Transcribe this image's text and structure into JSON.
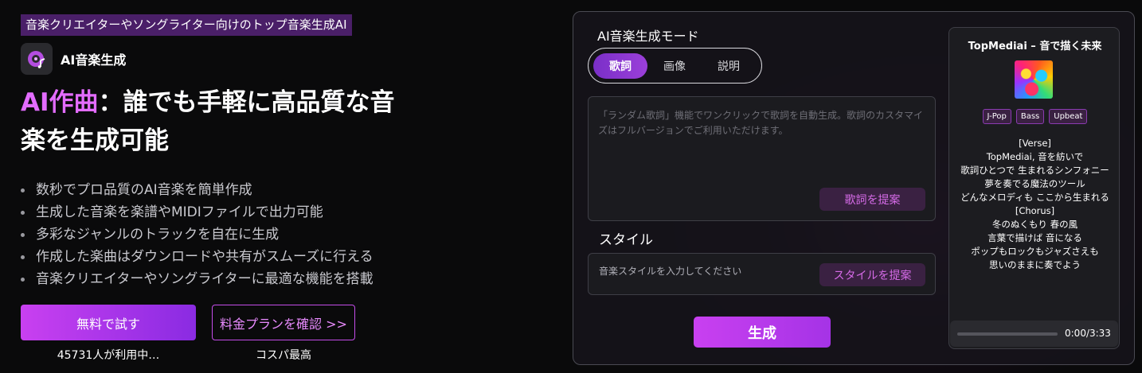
{
  "hero": {
    "top_tag": "音楽クリエイターやソングライター向けのトップ音楽生成AI",
    "brand_name": "AI音楽生成",
    "brand_icon": "music-disc-icon",
    "headline_accent": "AI作曲",
    "headline_rest": "：誰でも手軽に高品質な音楽を生成可能",
    "bullets": [
      "数秒でプロ品質のAI音楽を簡単作成",
      "生成した音楽を楽譜やMIDIファイルで出力可能",
      "多彩なジャンルのトラックを自在に生成",
      "作成した楽曲はダウンロードや共有がスムーズに行える",
      "音楽クリエイターやソングライターに最適な機能を搭載"
    ],
    "cta_primary": "無料で試す",
    "cta_primary_caption": "45731人が利用中…",
    "cta_secondary": "料金プランを確認 >>",
    "cta_secondary_caption": "コスパ最高",
    "accent_color": "#e36cff"
  },
  "generator": {
    "mode_title": "AI音楽生成モード",
    "tabs": [
      {
        "label": "歌詞",
        "active": true
      },
      {
        "label": "画像",
        "active": false
      },
      {
        "label": "説明",
        "active": false
      }
    ],
    "lyrics_placeholder": "「ランダム歌詞」機能でワンクリックで歌詞を自動生成。歌詞のカスタマイズはフルバージョンでご利用いただけます。",
    "suggest_lyrics_label": "歌詞を提案",
    "style_title": "スタイル",
    "style_placeholder": "音楽スタイルを入力してください",
    "suggest_style_label": "スタイルを提案",
    "generate_label": "生成"
  },
  "song_card": {
    "title": "TopMediai – 音で描く未来",
    "tags": [
      "J-Pop",
      "Bass",
      "Upbeat"
    ],
    "lyrics_lines": [
      "[Verse]",
      "TopMediai, 音を紡いで",
      "歌詞ひとつで 生まれるシンフォニー 夢を奏でる魔法のツール",
      "どんなメロディも ここから生まれる",
      "[Chorus]",
      "冬のぬくもり 春の風",
      "言葉で描けば 音になる",
      "ポップもロックもジャズさえも",
      "思いのままに奏でよう"
    ],
    "time_display": "0:00/3:33",
    "progress": 0
  }
}
